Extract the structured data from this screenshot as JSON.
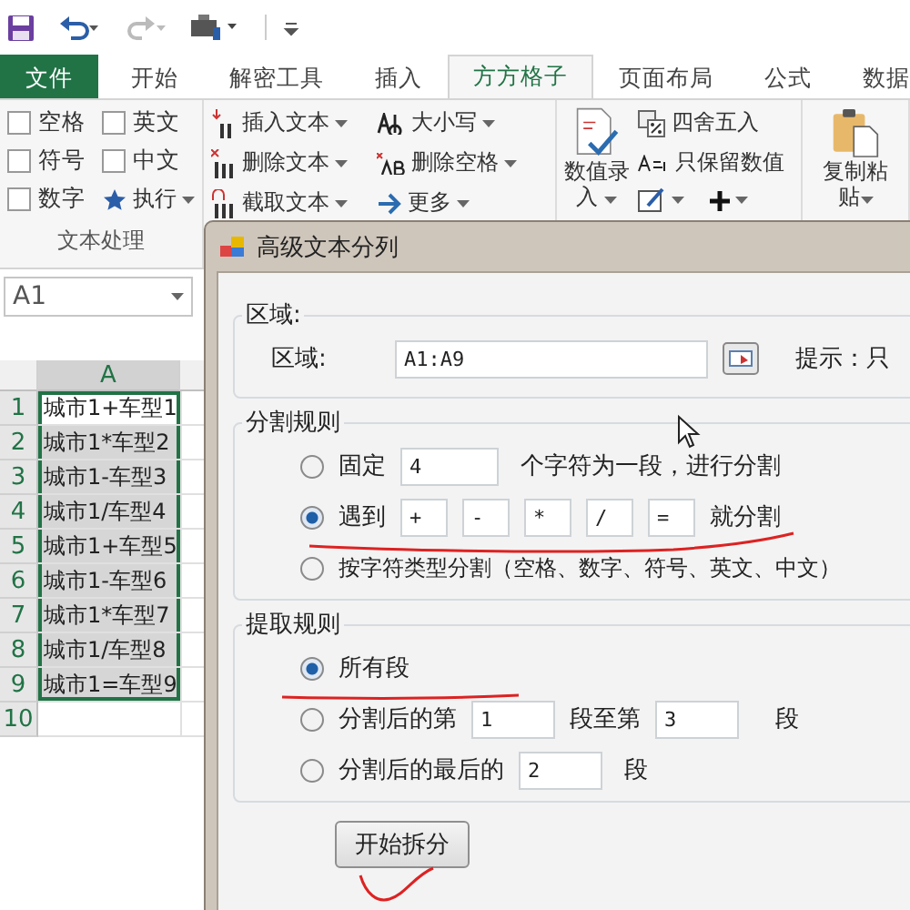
{
  "tabs": [
    {
      "label": "文件",
      "kind": "file",
      "selected": false
    },
    {
      "label": "开始",
      "kind": "tab",
      "selected": false
    },
    {
      "label": "解密工具",
      "kind": "tab",
      "selected": false
    },
    {
      "label": "插入",
      "kind": "tab",
      "selected": false
    },
    {
      "label": "方方格子",
      "kind": "tab",
      "selected": true
    },
    {
      "label": "页面布局",
      "kind": "tab",
      "selected": false
    },
    {
      "label": "公式",
      "kind": "tab",
      "selected": false
    },
    {
      "label": "数据",
      "kind": "tab",
      "selected": false
    }
  ],
  "ribbon": {
    "checkboxes": [
      {
        "label": "空格",
        "checked": false
      },
      {
        "label": "英文",
        "checked": false
      },
      {
        "label": "符号",
        "checked": false
      },
      {
        "label": "中文",
        "checked": false
      },
      {
        "label": "数字",
        "checked": false
      }
    ],
    "run_button": "执行",
    "group_label": "文本处理",
    "text_tools": [
      "插入文本",
      "删除文本",
      "截取文本"
    ],
    "case_tools": [
      "大小写",
      "删除空格",
      "更多"
    ],
    "number_entry": [
      "数值录",
      "入"
    ],
    "round_button": "四舍五入",
    "keep_numbers_button": "只保留数值",
    "paste_button": [
      "复制粘",
      "贴"
    ]
  },
  "sheet": {
    "name_box": "A1",
    "column": "A",
    "rows": [
      {
        "number": "1",
        "text": "城市1+车型1",
        "selected": false
      },
      {
        "number": "2",
        "text": "城市1*车型2",
        "selected": true
      },
      {
        "number": "3",
        "text": "城市1-车型3",
        "selected": true
      },
      {
        "number": "4",
        "text": "城市1/车型4",
        "selected": true
      },
      {
        "number": "5",
        "text": "城市1+车型5",
        "selected": true
      },
      {
        "number": "6",
        "text": "城市1-车型6",
        "selected": true
      },
      {
        "number": "7",
        "text": "城市1*车型7",
        "selected": true
      },
      {
        "number": "8",
        "text": "城市1/车型8",
        "selected": true
      },
      {
        "number": "9",
        "text": "城市1=车型9",
        "selected": true
      },
      {
        "number": "10",
        "text": "",
        "selected": false
      }
    ]
  },
  "dialog": {
    "title": "高级文本分列",
    "range_group": {
      "title": "区域:",
      "label": "区域:",
      "value": "A1:A9",
      "hint": "提示：只"
    },
    "split_group": {
      "title": "分割规则",
      "fixed": {
        "label": "固定",
        "selected": false,
        "value": "4",
        "suffix": "个字符为一段，进行分割"
      },
      "delimiter": {
        "label": "遇到",
        "selected": true,
        "values": [
          "+",
          "-",
          "*",
          "/",
          "="
        ],
        "suffix": "就分割"
      },
      "by_type": {
        "label": "按字符类型分割（空格、数字、符号、英文、中文）",
        "selected": false
      }
    },
    "extract_group": {
      "title": "提取规则",
      "all": {
        "label": "所有段",
        "selected": true
      },
      "range": {
        "label": "分割后的第",
        "selected": false,
        "from": "1",
        "middle": "段至第",
        "to": "3",
        "suffix": "段"
      },
      "last": {
        "label": "分割后的最后的",
        "selected": false,
        "value": "2",
        "suffix": "段"
      }
    },
    "start_button": "开始拆分"
  }
}
